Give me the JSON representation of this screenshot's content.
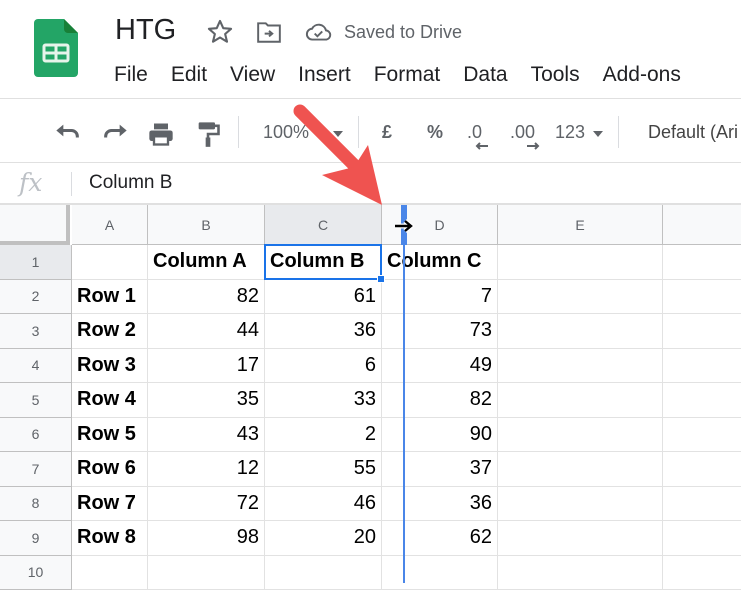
{
  "app": {
    "doc_title": "HTG",
    "save_status": "Saved to Drive",
    "icons": {
      "logo": "google-sheets-logo",
      "star": "star-icon",
      "folder": "move-to-folder-icon",
      "cloud": "cloud-saved-icon"
    }
  },
  "menu": [
    "File",
    "Edit",
    "View",
    "Insert",
    "Format",
    "Data",
    "Tools",
    "Add-ons"
  ],
  "toolbar": {
    "zoom": "100%",
    "currency": "£",
    "percent": "%",
    "decrease_decimal": ".0",
    "increase_decimal": ".00",
    "more_formats": "123",
    "font": "Default (Ari",
    "icons": [
      "undo-icon",
      "redo-icon",
      "print-icon",
      "paint-format-icon"
    ]
  },
  "formula_bar": {
    "fx_label": "fx",
    "value": "Column B"
  },
  "sheet": {
    "columns": [
      "A",
      "B",
      "C",
      "D",
      "E",
      ""
    ],
    "selected_column": "C",
    "selected_cell": "C1",
    "row_numbers": [
      "1",
      "2",
      "3",
      "4",
      "5",
      "6",
      "7",
      "8",
      "9",
      "10"
    ],
    "rows": [
      [
        "",
        "Column A",
        "Column B",
        "Column C",
        "",
        ""
      ],
      [
        "Row 1",
        "82",
        "61",
        "7",
        "",
        ""
      ],
      [
        "Row 2",
        "44",
        "36",
        "73",
        "",
        ""
      ],
      [
        "Row 3",
        "17",
        "6",
        "49",
        "",
        ""
      ],
      [
        "Row 4",
        "35",
        "33",
        "82",
        "",
        ""
      ],
      [
        "Row 5",
        "43",
        "2",
        "90",
        "",
        ""
      ],
      [
        "Row 6",
        "12",
        "55",
        "37",
        "",
        ""
      ],
      [
        "Row 7",
        "72",
        "46",
        "36",
        "",
        ""
      ],
      [
        "Row 8",
        "98",
        "20",
        "62",
        "",
        ""
      ],
      [
        "",
        "",
        "",
        "",
        "",
        ""
      ]
    ]
  },
  "annotation": {
    "type": "red-arrow",
    "points_to": "column-C-D-border-resize-handle",
    "color": "#ef5350"
  },
  "colors": {
    "accent": "#1a73e8",
    "sheets_green": "#23a566",
    "drag_guide": "#4a86e8"
  }
}
